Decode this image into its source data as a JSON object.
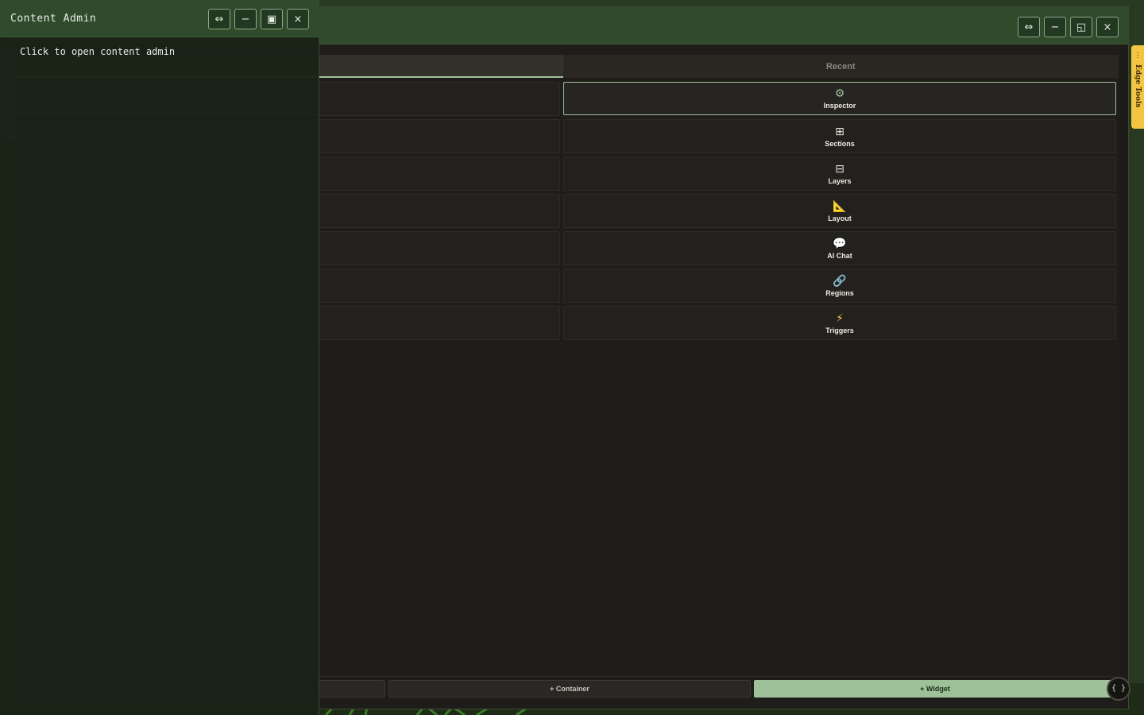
{
  "main_window": {
    "controls": {
      "swap_icon": "⇔",
      "minimize_icon": "−",
      "restore_icon": "◱",
      "close_icon": "×"
    },
    "tabs": [
      {
        "label": "",
        "active": true
      },
      {
        "label": "Recent",
        "active": false
      }
    ],
    "tools": [
      {
        "icon": "⚙",
        "label": "Inspector",
        "selected": true
      },
      {
        "icon": "⊞",
        "label": "Sections",
        "selected": false
      },
      {
        "icon": "⊟",
        "label": "Layers",
        "selected": false
      },
      {
        "icon": "📐",
        "label": "Layout",
        "selected": false
      },
      {
        "icon": "💬",
        "label": "AI Chat",
        "selected": false
      },
      {
        "icon": "🔗",
        "label": "Regions",
        "selected": false
      },
      {
        "icon": "⚡",
        "label": "Triggers",
        "selected": false
      }
    ],
    "bottom_buttons": {
      "container_label": "+ Container",
      "widget_label": "+ Widget"
    },
    "code_bubble": "{ }"
  },
  "edge_tools": {
    "dots": "⋮",
    "label": "Edge Tools"
  },
  "admin_window": {
    "title": "Content Admin",
    "controls": {
      "swap_icon": "⇔",
      "minimize_icon": "−",
      "maximize_icon": "▣",
      "close_icon": "×"
    },
    "body_text": "Click to open content admin"
  },
  "colors": {
    "titlebar": "#2f4b2c",
    "accent": "#9fc19a",
    "edge_tools": "#f4c542",
    "panel_bg": "#1e1d1a"
  }
}
